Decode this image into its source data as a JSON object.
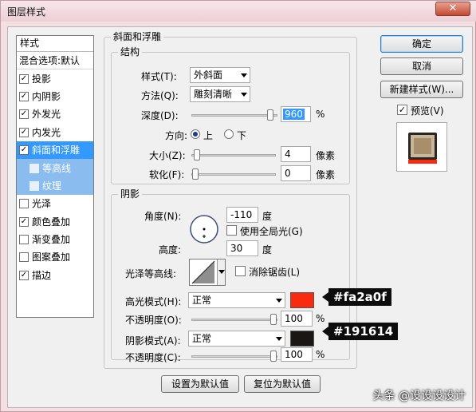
{
  "window": {
    "title": "图层样式",
    "close_glyph": "✕"
  },
  "styles_list": {
    "header": "样式",
    "blend_options": "混合选项:默认",
    "items": [
      {
        "label": "投影",
        "checked": true
      },
      {
        "label": "内阴影",
        "checked": true
      },
      {
        "label": "外发光",
        "checked": true
      },
      {
        "label": "内发光",
        "checked": true
      },
      {
        "label": "斜面和浮雕",
        "checked": true,
        "selected": true
      },
      {
        "label": "等高线",
        "checked": false,
        "sub": true
      },
      {
        "label": "纹理",
        "checked": false,
        "sub": true
      },
      {
        "label": "光泽",
        "checked": false
      },
      {
        "label": "颜色叠加",
        "checked": true
      },
      {
        "label": "渐变叠加",
        "checked": false
      },
      {
        "label": "图案叠加",
        "checked": false
      },
      {
        "label": "描边",
        "checked": true
      }
    ]
  },
  "bevel": {
    "section_title": "斜面和浮雕",
    "structure_title": "结构",
    "style_label": "样式(T):",
    "style_value": "外斜面",
    "technique_label": "方法(Q):",
    "technique_value": "雕刻清晰",
    "depth_label": "深度(D):",
    "depth_value": "960",
    "depth_unit": "%",
    "depth_level": 0.96,
    "direction_label": "方向:",
    "direction_up": "上",
    "direction_down": "下",
    "direction_selected": "up",
    "size_label": "大小(Z):",
    "size_value": "4",
    "size_unit": "像素",
    "size_level": 0.02,
    "soften_label": "软化(F):",
    "soften_value": "0",
    "soften_unit": "像素",
    "soften_level": 0.0
  },
  "shading": {
    "title": "阴影",
    "angle_label": "角度(N):",
    "angle_value": "-110",
    "angle_unit": "度",
    "global_light_label": "使用全局光(G)",
    "global_light_checked": false,
    "altitude_label": "高度:",
    "altitude_value": "30",
    "altitude_unit": "度",
    "gloss_contour_label": "光泽等高线:",
    "antialias_label": "消除锯齿(L)",
    "antialias_checked": false,
    "highlight_mode_label": "高光模式(H):",
    "highlight_mode_value": "正常",
    "highlight_color": "#fa2a0f",
    "highlight_callout": "#fa2a0f",
    "highlight_opacity_label": "不透明度(O):",
    "highlight_opacity_value": "100",
    "highlight_opacity_unit": "%",
    "highlight_opacity_level": 1.0,
    "shadow_mode_label": "阴影模式(A):",
    "shadow_mode_value": "正常",
    "shadow_color": "#191614",
    "shadow_callout": "#191614",
    "shadow_opacity_label": "不透明度(C):",
    "shadow_opacity_value": "100",
    "shadow_opacity_unit": "%",
    "shadow_opacity_level": 1.0
  },
  "footer": {
    "make_default": "设置为默认值",
    "reset_default": "复位为默认值"
  },
  "actions": {
    "ok": "确定",
    "cancel": "取消",
    "new_style": "新建样式(W)...",
    "preview_label": "预览(V)",
    "preview_checked": true
  },
  "watermark": "头条 @设设设设计"
}
